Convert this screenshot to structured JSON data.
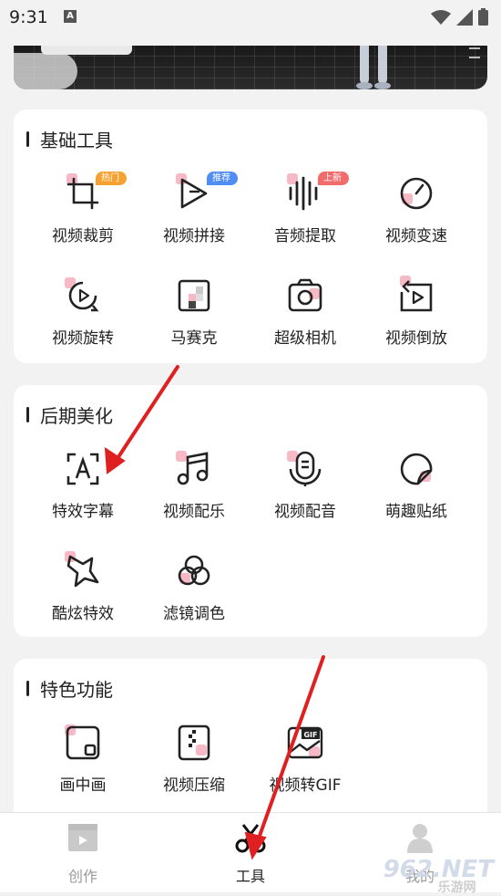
{
  "status_bar": {
    "time": "9:31",
    "notif_letter": "A"
  },
  "sections": [
    {
      "title": "基础工具",
      "tools": [
        {
          "label": "视频裁剪",
          "icon": "crop-icon",
          "badge": "热门",
          "badge_color": "#f7a230"
        },
        {
          "label": "视频拼接",
          "icon": "play-join-icon",
          "badge": "推荐",
          "badge_color": "#4f8df5"
        },
        {
          "label": "音频提取",
          "icon": "audio-wave-icon",
          "badge": "上新",
          "badge_color": "#f26b6b"
        },
        {
          "label": "视频变速",
          "icon": "speedometer-icon"
        },
        {
          "label": "视频旋转",
          "icon": "rotate-icon"
        },
        {
          "label": "马赛克",
          "icon": "mosaic-icon"
        },
        {
          "label": "超级相机",
          "icon": "camera-icon"
        },
        {
          "label": "视频倒放",
          "icon": "reverse-play-icon"
        }
      ]
    },
    {
      "title": "后期美化",
      "tools": [
        {
          "label": "特效字幕",
          "icon": "subtitle-icon"
        },
        {
          "label": "视频配乐",
          "icon": "music-note-icon"
        },
        {
          "label": "视频配音",
          "icon": "microphone-icon"
        },
        {
          "label": "萌趣贴纸",
          "icon": "sticker-icon"
        },
        {
          "label": "酷炫特效",
          "icon": "star-effect-icon"
        },
        {
          "label": "滤镜调色",
          "icon": "filter-icon"
        }
      ]
    },
    {
      "title": "特色功能",
      "tools": [
        {
          "label": "画中画",
          "icon": "picture-in-picture-icon"
        },
        {
          "label": "视频压缩",
          "icon": "zip-icon"
        },
        {
          "label": "视频转GIF",
          "icon": "gif-icon"
        }
      ]
    }
  ],
  "bottom_nav": [
    {
      "label": "创作",
      "icon": "clapperboard-icon",
      "active": false
    },
    {
      "label": "工具",
      "icon": "scissors-icon",
      "active": true
    },
    {
      "label": "我的",
      "icon": "profile-icon",
      "active": false
    }
  ],
  "watermark": {
    "text": "962.NET",
    "sub": "乐游网"
  },
  "colors": {
    "accent_pink": "#f7b9c6",
    "arrow_red": "#e02020",
    "active_text": "#222222",
    "inactive_text": "#999999"
  }
}
